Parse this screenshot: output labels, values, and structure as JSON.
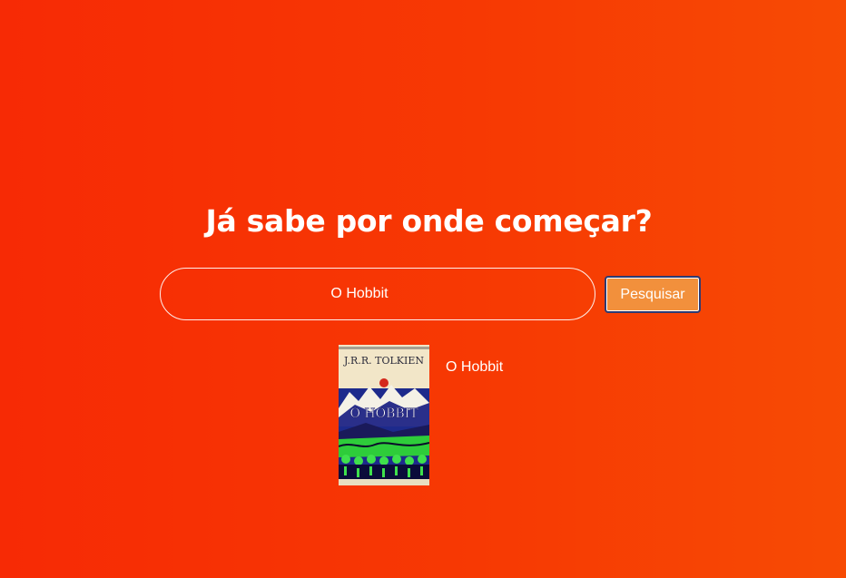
{
  "heading": "Já sabe por onde começar?",
  "search": {
    "value": "O Hobbit",
    "button_label": "Pesquisar"
  },
  "results": [
    {
      "title": "O Hobbit",
      "cover": {
        "author": "J.R.R. TOLKIEN",
        "title": "O HOBBIT"
      }
    }
  ],
  "colors": {
    "background_start": "#f72a05",
    "background_end": "#f74b04",
    "button_bg": "#f2903c",
    "button_border": "#2e3a70"
  }
}
